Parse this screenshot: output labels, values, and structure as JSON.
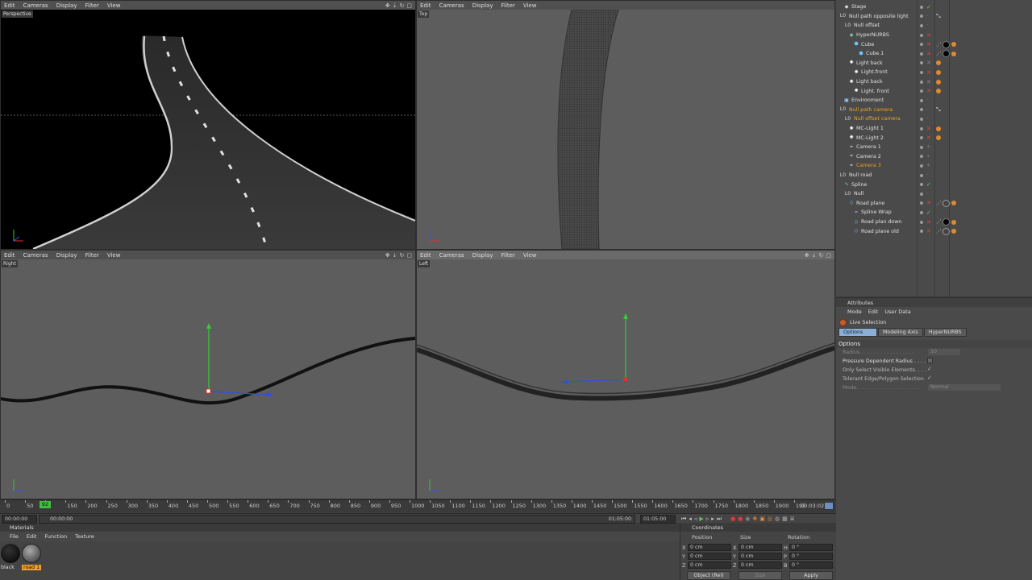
{
  "viewport_menu": [
    "Edit",
    "Cameras",
    "Display",
    "Filter",
    "View"
  ],
  "viewports": {
    "tl": {
      "label": "Perspective"
    },
    "tr": {
      "label": "Top"
    },
    "bl": {
      "label": "Right"
    },
    "br": {
      "label": "Left"
    }
  },
  "object_manager": {
    "rows": [
      {
        "name": "Stage",
        "indent": 1,
        "icon": "stage",
        "tags": []
      },
      {
        "name": "Null path opposite light",
        "indent": 0,
        "icon": "null",
        "tags": [
          "align"
        ]
      },
      {
        "name": "Null offset",
        "indent": 1,
        "icon": "null",
        "tags": []
      },
      {
        "name": "HyperNURBS",
        "indent": 2,
        "icon": "hypernurbs",
        "tags": []
      },
      {
        "name": "Cube",
        "indent": 3,
        "icon": "cube",
        "tags": [
          "phong",
          "black",
          "orange"
        ]
      },
      {
        "name": "Cube.1",
        "indent": 4,
        "icon": "cube",
        "tags": [
          "phong",
          "black",
          "orange"
        ]
      },
      {
        "name": "Light back",
        "indent": 2,
        "icon": "light",
        "tags": [
          "orange"
        ]
      },
      {
        "name": "Light.front",
        "indent": 3,
        "icon": "light",
        "tags": [
          "orange"
        ]
      },
      {
        "name": "Light back",
        "indent": 2,
        "icon": "light",
        "tags": [
          "orange"
        ]
      },
      {
        "name": "Light. front",
        "indent": 3,
        "icon": "light",
        "tags": [
          "orange"
        ]
      },
      {
        "name": "Environment",
        "indent": 1,
        "icon": "env",
        "tags": []
      },
      {
        "name": "Null path camera",
        "indent": 0,
        "icon": "null",
        "tags": [
          "align"
        ],
        "highlight": true
      },
      {
        "name": "Null offset camera",
        "indent": 1,
        "icon": "null",
        "tags": [],
        "highlight": true
      },
      {
        "name": "MC-Light 1",
        "indent": 2,
        "icon": "light",
        "tags": [
          "orange"
        ]
      },
      {
        "name": "MC-Light 2",
        "indent": 2,
        "icon": "light",
        "tags": [
          "orange"
        ]
      },
      {
        "name": "Camera 1",
        "indent": 2,
        "icon": "camera",
        "tags": []
      },
      {
        "name": "Camera 2",
        "indent": 2,
        "icon": "camera",
        "tags": []
      },
      {
        "name": "Camera 3",
        "indent": 2,
        "icon": "camera",
        "tags": [],
        "highlight": true
      },
      {
        "name": "Null road",
        "indent": 0,
        "icon": "null",
        "tags": []
      },
      {
        "name": "Spline",
        "indent": 1,
        "icon": "spline",
        "tags": []
      },
      {
        "name": "Null",
        "indent": 1,
        "icon": "null",
        "tags": []
      },
      {
        "name": "Road plane",
        "indent": 2,
        "icon": "plane",
        "tags": [
          "phong",
          "grey",
          "orange"
        ]
      },
      {
        "name": "Spline Wrap",
        "indent": 3,
        "icon": "wrap",
        "tags": []
      },
      {
        "name": "Road plan down",
        "indent": 3,
        "icon": "plane",
        "tags": [
          "phong",
          "black",
          "orange"
        ]
      },
      {
        "name": "Road plane old",
        "indent": 3,
        "icon": "plane",
        "tags": [
          "phong",
          "grey",
          "orange"
        ]
      }
    ]
  },
  "attributes": {
    "title": "Attributes",
    "menu": [
      "Mode",
      "Edit",
      "User Data"
    ],
    "tool": "Live Selection",
    "tabs": [
      "Options",
      "Modeling Axis",
      "HyperNURBS"
    ],
    "section": "Options",
    "radius_label": "Radius . . . . . . . . . . . . . . . . .",
    "radius_value": "10",
    "pressure_label": "Pressure Dependent Radius . . . .",
    "visible_label": "Only Select Visible Elements. . . .",
    "tolerant_label": "Tolerant Edge/Polygon Selection",
    "mode_label": "Mode. . . . . . . . . . . . . . . . . . . .",
    "mode_value": "Normal"
  },
  "timeline": {
    "ticks": [
      "0",
      "50",
      "92",
      "150",
      "200",
      "250",
      "300",
      "350",
      "400",
      "450",
      "500",
      "550",
      "600",
      "650",
      "700",
      "750",
      "800",
      "850",
      "900",
      "950",
      "1000",
      "1050",
      "1100",
      "1150",
      "1200",
      "1250",
      "1300",
      "1350",
      "1400",
      "1450",
      "1500",
      "1550",
      "1600",
      "1650",
      "1700",
      "1750",
      "1800",
      "1850",
      "1900",
      "195"
    ],
    "current_frame": "92",
    "end_time": "00:03:02",
    "start_field": "00:00:00",
    "start_field2": "00:00:00",
    "mid_field": "01:05:00",
    "end_field": "01:05:00"
  },
  "materials": {
    "title": "Materials",
    "menu": [
      "File",
      "Edit",
      "Function",
      "Texture"
    ],
    "items": [
      {
        "name": "black"
      },
      {
        "name": "road 1",
        "selected": true
      }
    ]
  },
  "coordinates": {
    "title": "Coordinates",
    "cols": [
      "Position",
      "Size",
      "Rotation"
    ],
    "rows": [
      {
        "axis": "X",
        "pos": "0 cm",
        "size_axis": "X",
        "size": "0 cm",
        "rot_axis": "H",
        "rot": "0 °"
      },
      {
        "axis": "Y",
        "pos": "0 cm",
        "size_axis": "Y",
        "size": "0 cm",
        "rot_axis": "P",
        "rot": "0 °"
      },
      {
        "axis": "Z",
        "pos": "0 cm",
        "size_axis": "Z",
        "size": "0 cm",
        "rot_axis": "B",
        "rot": "0 °"
      }
    ],
    "mode": "Object (Rel)",
    "size_mode": "Size",
    "apply": "Apply"
  },
  "colors": {
    "accent": "#f0a020",
    "tab_active": "#8ab0d8",
    "axis_y": "#30d030",
    "axis_x": "#3050e0",
    "axis_z": "#2040c0",
    "handle": "#e03030"
  }
}
